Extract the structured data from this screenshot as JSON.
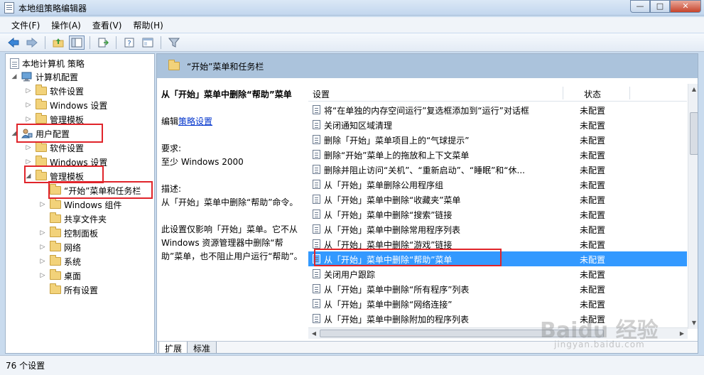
{
  "window": {
    "title": "本地组策略编辑器",
    "buttons": {
      "minimize": "—",
      "maximize": "□",
      "close": "✕"
    }
  },
  "menu": [
    "文件(F)",
    "操作(A)",
    "查看(V)",
    "帮助(H)"
  ],
  "toolbar_icons": [
    "back-arrow-icon",
    "forward-arrow-icon",
    "up-folder-icon",
    "show-hide-tree-icon",
    "export-list-icon",
    "help-icon",
    "properties-icon",
    "filter-icon"
  ],
  "tree": [
    {
      "label": "本地计算机 策略",
      "level": 0,
      "icon": "doc"
    },
    {
      "label": "计算机配置",
      "level": 1,
      "icon": "pc",
      "expanded": true
    },
    {
      "label": "软件设置",
      "level": 2,
      "icon": "folder"
    },
    {
      "label": "Windows 设置",
      "level": 2,
      "icon": "folder"
    },
    {
      "label": "管理模板",
      "level": 2,
      "icon": "folder"
    },
    {
      "label": "用户配置",
      "level": 1,
      "icon": "user",
      "expanded": true
    },
    {
      "label": "软件设置",
      "level": 2,
      "icon": "folder"
    },
    {
      "label": "Windows 设置",
      "level": 2,
      "icon": "folder"
    },
    {
      "label": "管理模板",
      "level": 2,
      "icon": "folder",
      "expanded": true
    },
    {
      "label": "“开始”菜单和任务栏",
      "level": 3,
      "icon": "folder"
    },
    {
      "label": "Windows 组件",
      "level": 3,
      "icon": "folder"
    },
    {
      "label": "共享文件夹",
      "level": 3,
      "icon": "folder"
    },
    {
      "label": "控制面板",
      "level": 3,
      "icon": "folder"
    },
    {
      "label": "网络",
      "level": 3,
      "icon": "folder"
    },
    {
      "label": "系统",
      "level": 3,
      "icon": "folder"
    },
    {
      "label": "桌面",
      "level": 3,
      "icon": "folder"
    },
    {
      "label": "所有设置",
      "level": 3,
      "icon": "folder"
    }
  ],
  "content": {
    "header_title": "“开始”菜单和任务栏",
    "description": {
      "heading": "从「开始」菜单中删除“帮助”菜单",
      "edit_prefix": "编辑",
      "edit_link": "策略设置",
      "req_label": "要求:",
      "req_value": "至少 Windows 2000",
      "desc_label": "描述:",
      "desc_text": "从「开始」菜单中删除“帮助”命令。",
      "desc_more": "此设置仅影响「开始」菜单。它不从 Windows 资源管理器中删除“帮助”菜单，也不阻止用户运行“帮助”。"
    },
    "columns": {
      "setting": "设置",
      "state": "状态"
    },
    "rows": [
      {
        "name": "将“在单独的内存空间运行”复选框添加到“运行”对话框",
        "state": "未配置"
      },
      {
        "name": "关闭通知区域清理",
        "state": "未配置"
      },
      {
        "name": "删除「开始」菜单项目上的“气球提示”",
        "state": "未配置"
      },
      {
        "name": "删除“开始”菜单上的拖放和上下文菜单",
        "state": "未配置"
      },
      {
        "name": "删除并阻止访问“关机”、“重新启动”、“睡眠”和“休...",
        "state": "未配置"
      },
      {
        "name": "从「开始」菜单删除公用程序组",
        "state": "未配置"
      },
      {
        "name": "从「开始」菜单中删除“收藏夹”菜单",
        "state": "未配置"
      },
      {
        "name": "从「开始」菜单中删除“搜索”链接",
        "state": "未配置"
      },
      {
        "name": "从「开始」菜单中删除常用程序列表",
        "state": "未配置"
      },
      {
        "name": "从「开始」菜单中删除“游戏”链接",
        "state": "未配置"
      },
      {
        "name": "从「开始」菜单中删除“帮助”菜单",
        "state": "未配置",
        "selected": true
      },
      {
        "name": "关闭用户跟踪",
        "state": "未配置"
      },
      {
        "name": "从「开始」菜单中删除“所有程序”列表",
        "state": "未配置"
      },
      {
        "name": "从「开始」菜单中删除“网络连接”",
        "state": "未配置"
      },
      {
        "name": "从「开始」菜单中删除附加的程序列表",
        "state": "未配置"
      }
    ],
    "tabs": [
      "扩展",
      "标准"
    ]
  },
  "status": "76 个设置",
  "watermark": {
    "main": "Baidu 经验",
    "sub": "jingyan.baidu.com"
  }
}
